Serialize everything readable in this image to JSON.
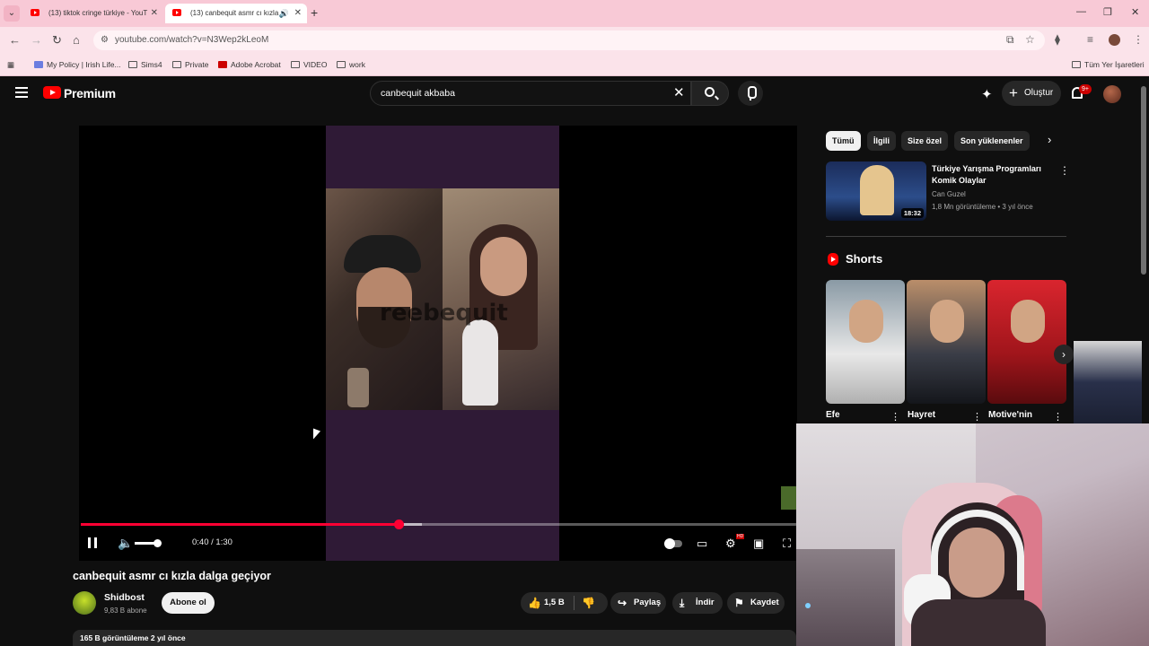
{
  "browser": {
    "tabs": [
      {
        "title": "(13) tiktok cringe türkiye - YouT",
        "active": false
      },
      {
        "title": "(13) canbequit asmr cı kızla",
        "active": true
      }
    ],
    "url": "youtube.com/watch?v=N3Wep2kLeoM",
    "bookmarks": [
      "My Policy | Irish Life...",
      "Sims4",
      "Private",
      "Adobe Acrobat",
      "VIDEO",
      "work"
    ],
    "all_bookmarks": "Tüm Yer İşaretleri"
  },
  "header": {
    "logo_text": "Premium",
    "search_value": "canbequit akbaba",
    "create_label": "Oluştur",
    "notification_count": "9+"
  },
  "player": {
    "watermark": "reebequit",
    "time": "0:40 / 1:30",
    "progress_fraction": 0.444,
    "volume_fraction": 0.8,
    "quality_badge": "HD"
  },
  "video": {
    "title": "canbequit asmr cı kızla dalga geçiyor",
    "channel": "Shidbost",
    "subscribers": "9,83 B abone",
    "subscribe_label": "Abone ol",
    "likes": "1,5 B",
    "share_label": "Paylaş",
    "download_label": "İndir",
    "save_label": "Kaydet",
    "views_date": "165 B görüntüleme  2 yıl önce"
  },
  "sidebar": {
    "chips": [
      {
        "label": "Tümü",
        "selected": true
      },
      {
        "label": "İlgili",
        "selected": false
      },
      {
        "label": "Size özel",
        "selected": false
      },
      {
        "label": "Son yüklenenler",
        "selected": false
      }
    ],
    "recommended": {
      "title": "Türkiye Yarışma Programları Komik Olaylar",
      "channel": "Can Guzel",
      "meta": "1,8 Mn görüntüleme • 3 yıl önce",
      "duration": "18:32"
    },
    "shorts_title": "Shorts",
    "shorts": [
      "Efe",
      "Hayret",
      "Motive'nin"
    ]
  },
  "colors": {
    "accent": "#ff0033",
    "tab_bar": "#f8c9d6",
    "background": "#0f0f0f"
  },
  "icons": [
    "menu-icon",
    "youtube-logo-icon",
    "search-icon",
    "mic-icon",
    "bell-icon",
    "pause-icon",
    "volume-icon",
    "settings-icon",
    "fullscreen-icon",
    "like-icon",
    "dislike-icon",
    "share-icon",
    "download-icon",
    "save-icon"
  ]
}
